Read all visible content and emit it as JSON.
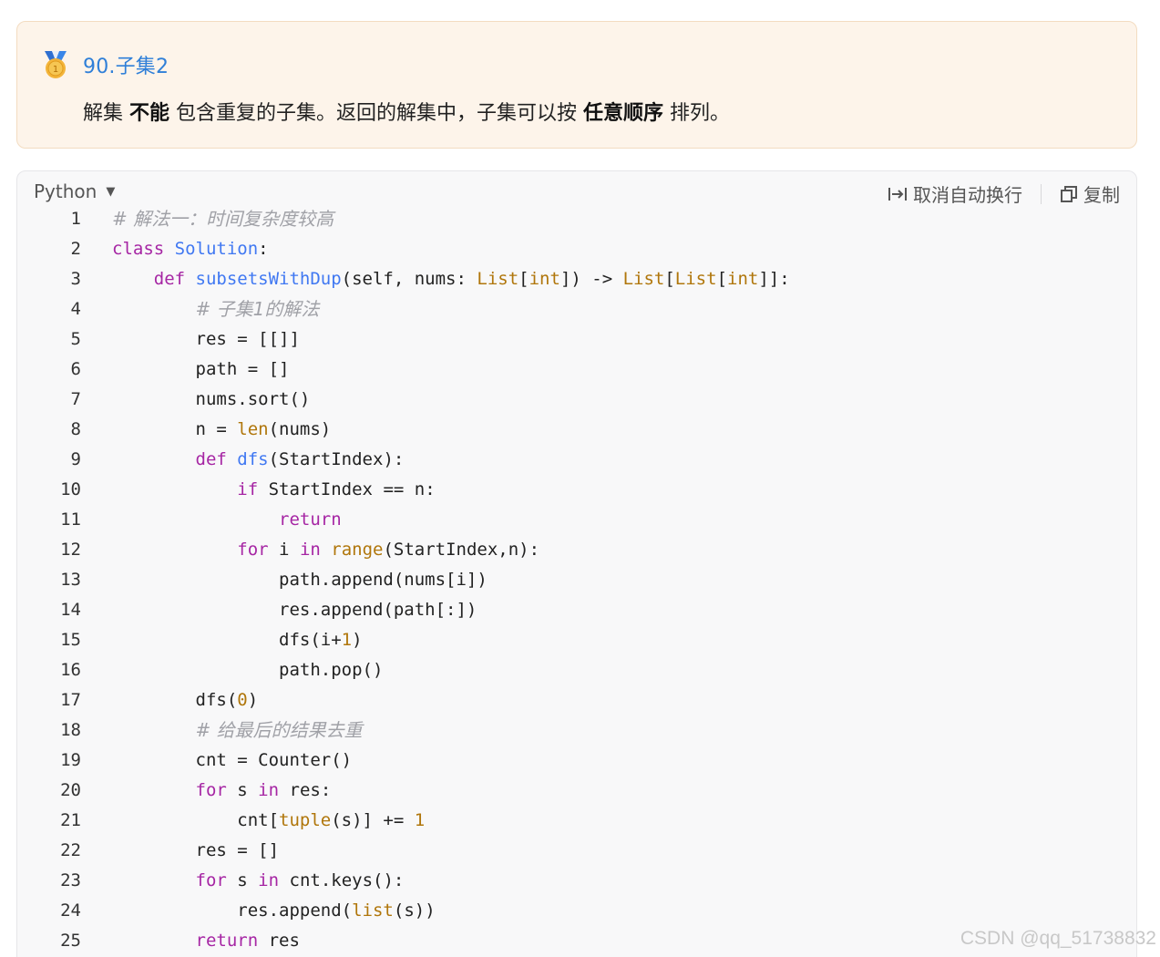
{
  "notice": {
    "title": "90.子集2",
    "text_1": "解集 ",
    "bold_1": "不能",
    "text_2": " 包含重复的子集。返回的解集中，子集可以按 ",
    "bold_2": "任意顺序",
    "text_3": " 排列。",
    "icon": "medal-icon"
  },
  "codeblock": {
    "language": "Python",
    "wrap_label": "取消自动换行",
    "copy_label": "复制",
    "line_numbers": [
      "1",
      "2",
      "3",
      "4",
      "5",
      "6",
      "7",
      "8",
      "9",
      "10",
      "11",
      "12",
      "13",
      "14",
      "15",
      "16",
      "17",
      "18",
      "19",
      "20",
      "21",
      "22",
      "23",
      "24",
      "25"
    ],
    "lines": [
      [
        {
          "t": "# 解法一：时间复杂度较高",
          "c": "cm"
        }
      ],
      [
        {
          "t": "class ",
          "c": "kw"
        },
        {
          "t": "Solution",
          "c": "fn"
        },
        {
          "t": ":",
          "c": "pn"
        }
      ],
      [
        {
          "t": "    def ",
          "c": "kw"
        },
        {
          "t": "subsetsWithDup",
          "c": "fn"
        },
        {
          "t": "(self, nums: ",
          "c": "pn"
        },
        {
          "t": "List",
          "c": "bi"
        },
        {
          "t": "[",
          "c": "pn"
        },
        {
          "t": "int",
          "c": "bi"
        },
        {
          "t": "]) -> ",
          "c": "pn"
        },
        {
          "t": "List",
          "c": "bi"
        },
        {
          "t": "[",
          "c": "pn"
        },
        {
          "t": "List",
          "c": "bi"
        },
        {
          "t": "[",
          "c": "pn"
        },
        {
          "t": "int",
          "c": "bi"
        },
        {
          "t": "]]:",
          "c": "pn"
        }
      ],
      [
        {
          "t": "        ",
          "c": "pn"
        },
        {
          "t": "# 子集1的解法",
          "c": "cm"
        }
      ],
      [
        {
          "t": "        res = [[]]",
          "c": "pn"
        }
      ],
      [
        {
          "t": "        path = []",
          "c": "pn"
        }
      ],
      [
        {
          "t": "        nums.sort()",
          "c": "pn"
        }
      ],
      [
        {
          "t": "        n = ",
          "c": "pn"
        },
        {
          "t": "len",
          "c": "bi"
        },
        {
          "t": "(nums)",
          "c": "pn"
        }
      ],
      [
        {
          "t": "        def ",
          "c": "kw"
        },
        {
          "t": "dfs",
          "c": "fn"
        },
        {
          "t": "(StartIndex):",
          "c": "pn"
        }
      ],
      [
        {
          "t": "            ",
          "c": "pn"
        },
        {
          "t": "if ",
          "c": "kw"
        },
        {
          "t": "StartIndex == n:",
          "c": "pn"
        }
      ],
      [
        {
          "t": "                ",
          "c": "pn"
        },
        {
          "t": "return",
          "c": "kw"
        }
      ],
      [
        {
          "t": "            ",
          "c": "pn"
        },
        {
          "t": "for ",
          "c": "kw"
        },
        {
          "t": "i ",
          "c": "pn"
        },
        {
          "t": "in ",
          "c": "kw"
        },
        {
          "t": "range",
          "c": "bi"
        },
        {
          "t": "(StartIndex,n):",
          "c": "pn"
        }
      ],
      [
        {
          "t": "                path.append(nums[i])",
          "c": "pn"
        }
      ],
      [
        {
          "t": "                res.append(path[:])",
          "c": "pn"
        }
      ],
      [
        {
          "t": "                dfs(i+",
          "c": "pn"
        },
        {
          "t": "1",
          "c": "num"
        },
        {
          "t": ")",
          "c": "pn"
        }
      ],
      [
        {
          "t": "                path.pop()",
          "c": "pn"
        }
      ],
      [
        {
          "t": "        dfs(",
          "c": "pn"
        },
        {
          "t": "0",
          "c": "num"
        },
        {
          "t": ")",
          "c": "pn"
        }
      ],
      [
        {
          "t": "        ",
          "c": "pn"
        },
        {
          "t": "# 给最后的结果去重",
          "c": "cm"
        }
      ],
      [
        {
          "t": "        cnt = Counter()",
          "c": "pn"
        }
      ],
      [
        {
          "t": "        ",
          "c": "pn"
        },
        {
          "t": "for ",
          "c": "kw"
        },
        {
          "t": "s ",
          "c": "pn"
        },
        {
          "t": "in ",
          "c": "kw"
        },
        {
          "t": "res:",
          "c": "pn"
        }
      ],
      [
        {
          "t": "            cnt[",
          "c": "pn"
        },
        {
          "t": "tuple",
          "c": "bi"
        },
        {
          "t": "(s)] += ",
          "c": "pn"
        },
        {
          "t": "1",
          "c": "num"
        }
      ],
      [
        {
          "t": "        res = []",
          "c": "pn"
        }
      ],
      [
        {
          "t": "        ",
          "c": "pn"
        },
        {
          "t": "for ",
          "c": "kw"
        },
        {
          "t": "s ",
          "c": "pn"
        },
        {
          "t": "in ",
          "c": "kw"
        },
        {
          "t": "cnt.keys():",
          "c": "pn"
        }
      ],
      [
        {
          "t": "            res.append(",
          "c": "pn"
        },
        {
          "t": "list",
          "c": "bi"
        },
        {
          "t": "(s))",
          "c": "pn"
        }
      ],
      [
        {
          "t": "        ",
          "c": "pn"
        },
        {
          "t": "return ",
          "c": "kw"
        },
        {
          "t": "res",
          "c": "pn"
        }
      ]
    ]
  },
  "watermark": "CSDN @qq_51738832",
  "colors": {
    "notice_bg": "#fdf4ea",
    "title": "#2f7fd8",
    "keyword": "#a626a4",
    "function": "#4078f2",
    "builtin": "#b0760b",
    "comment": "#a0a1a7"
  }
}
